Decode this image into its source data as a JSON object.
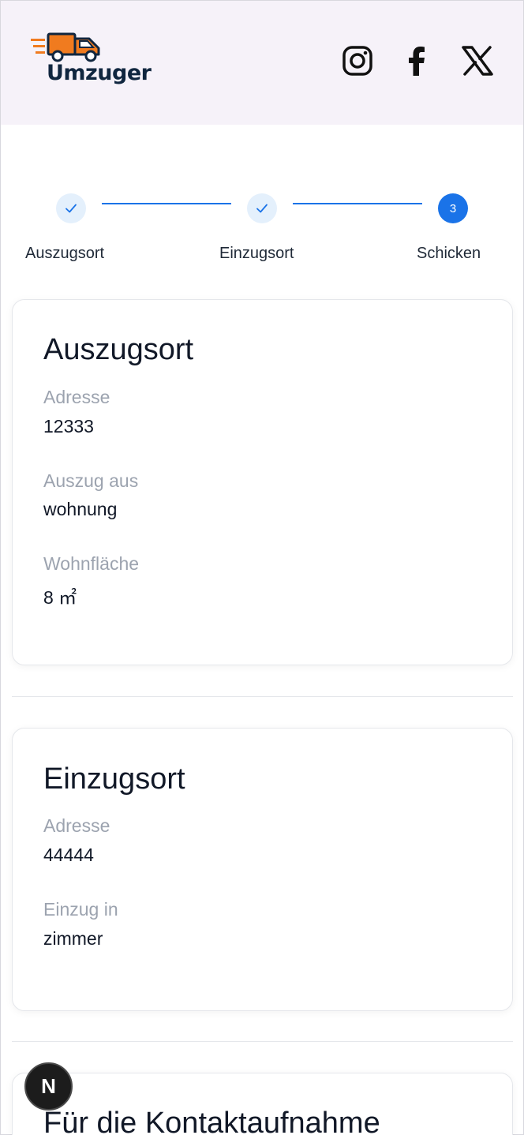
{
  "header": {
    "logo_text": "Umzuger",
    "social": [
      "instagram-icon",
      "facebook-icon",
      "x-icon"
    ]
  },
  "stepper": {
    "steps": [
      {
        "label": "Auszugsort",
        "state": "done"
      },
      {
        "label": "Einzugsort",
        "state": "done"
      },
      {
        "label": "Schicken",
        "state": "active",
        "number": "3"
      }
    ],
    "accent": "#1a73e8"
  },
  "auszug": {
    "title": "Auszugsort",
    "address_label": "Adresse",
    "address_value": "12333",
    "from_label": "Auszug aus",
    "from_value": "wohnung",
    "area_label": "Wohnfläche",
    "area_value": "8 ㎡"
  },
  "einzug": {
    "title": "Einzugsort",
    "address_label": "Adresse",
    "address_value": "44444",
    "into_label": "Einzug in",
    "into_value": "zimmer"
  },
  "kontakt": {
    "title": "Für die Kontaktaufnahme"
  },
  "dev_badge": "N"
}
